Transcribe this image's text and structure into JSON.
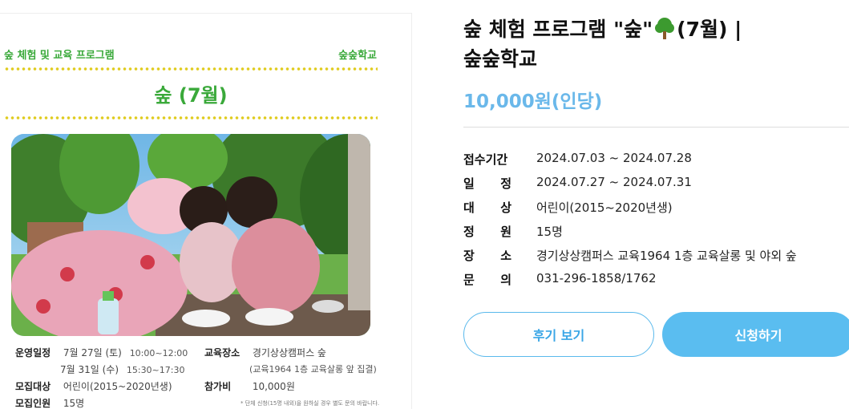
{
  "poster": {
    "header_left": "숲 체험 및 교육 프로그램",
    "header_right": "숲숲학교",
    "title": "숲 (7월)",
    "info": {
      "schedule_label": "운영일정",
      "schedule_1_date": "7월 27일 (토)",
      "schedule_1_time": "10:00~12:00",
      "schedule_2_date": "7월 31일 (수)",
      "schedule_2_time": "15:30~17:30",
      "place_label": "교육장소",
      "place_value": "경기상상캠퍼스 숲",
      "place_note": "(교육1964 1층 교육살롱 앞 집결)",
      "target_label": "모집대상",
      "target_value": "어린이(2015~2020년생)",
      "fee_label": "참가비",
      "fee_value": "10,000원",
      "capacity_label": "모집인원",
      "capacity_value": "15명"
    },
    "note": "* 단체 신청(15명 내외)을 원하실 경우 별도 문의 바랍니다."
  },
  "product": {
    "title_part1": "숲 체험 프로그램 \"숲\"",
    "title_part2": "(7월) |",
    "title_part3": "숲숲학교",
    "price": "10,000원(인당)"
  },
  "specs": [
    {
      "label": "접수기간",
      "value": "2024.07.03 ~ 2024.07.28"
    },
    {
      "label": "일정",
      "value": "2024.07.27 ~ 2024.07.31"
    },
    {
      "label": "대상",
      "value": "어린이(2015~2020년생)"
    },
    {
      "label": "정원",
      "value": "15명"
    },
    {
      "label": "장소",
      "value": "경기상상캠퍼스 교육1964 1층 교육살롱 및 야외 숲"
    },
    {
      "label": "문의",
      "value": "031-296-1858/1762"
    }
  ],
  "buttons": {
    "review": "후기 보기",
    "apply": "신청하기"
  },
  "colors": {
    "poster_green": "#3aa93a",
    "price_blue": "#6ab8ea",
    "apply_bg": "#5abdf0"
  }
}
